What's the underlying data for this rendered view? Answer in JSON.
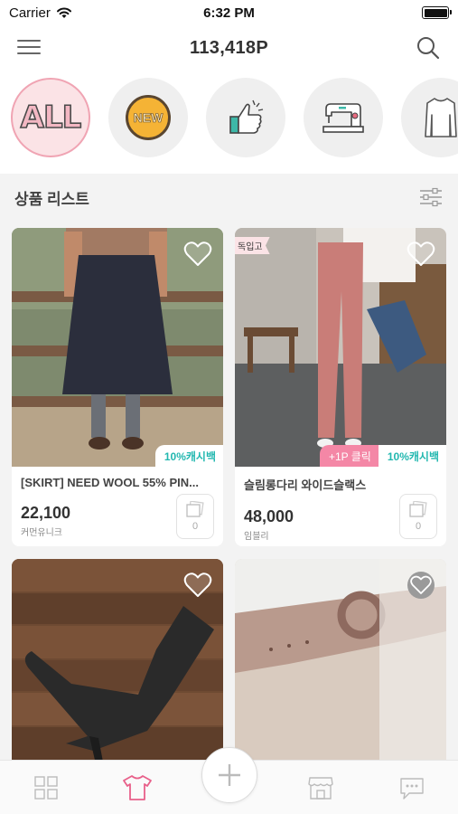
{
  "status_bar": {
    "carrier": "Carrier",
    "time": "6:32 PM"
  },
  "header": {
    "title": "113,418P"
  },
  "categories": [
    {
      "name": "ALL",
      "icon": "all-text-icon",
      "active": true
    },
    {
      "name": "NEW",
      "icon": "new-badge-icon",
      "active": false
    },
    {
      "name": "recommend",
      "icon": "thumbs-up-icon",
      "active": false
    },
    {
      "name": "handmade",
      "icon": "sewing-machine-icon",
      "active": false
    },
    {
      "name": "tops",
      "icon": "top-shirt-icon",
      "active": false
    }
  ],
  "list_header": {
    "title": "상품 리스트"
  },
  "products": [
    {
      "name": "[SKIRT] NEED WOOL 55% PIN...",
      "price": "22,100",
      "brand": "커먼유니크",
      "cashback": "10%캐시백",
      "click_tag": "",
      "ribbon": "",
      "review_count": "0"
    },
    {
      "name": "슬림롱다리 와이드슬랙스",
      "price": "48,000",
      "brand": "임블리",
      "cashback": "10%캐시백",
      "click_tag": "+1P 클릭",
      "ribbon": "독입고",
      "review_count": "0"
    },
    {
      "name": "",
      "price": "",
      "brand": "",
      "cashback": "",
      "click_tag": "",
      "ribbon": "",
      "review_count": ""
    },
    {
      "name": "",
      "price": "",
      "brand": "",
      "cashback": "",
      "click_tag": "",
      "ribbon": "",
      "review_count": ""
    }
  ],
  "tab_bar": {
    "items": [
      {
        "icon": "grid-icon",
        "active": false
      },
      {
        "icon": "tshirt-icon",
        "active": true
      },
      {
        "icon": "plus-icon",
        "active": false
      },
      {
        "icon": "store-icon",
        "active": false
      },
      {
        "icon": "chat-icon",
        "active": false
      }
    ]
  },
  "colors": {
    "accent_pink": "#f487a6",
    "cashback_teal": "#23b8b0",
    "active_tab": "#e8608a",
    "list_bg": "#f3f3f3"
  }
}
